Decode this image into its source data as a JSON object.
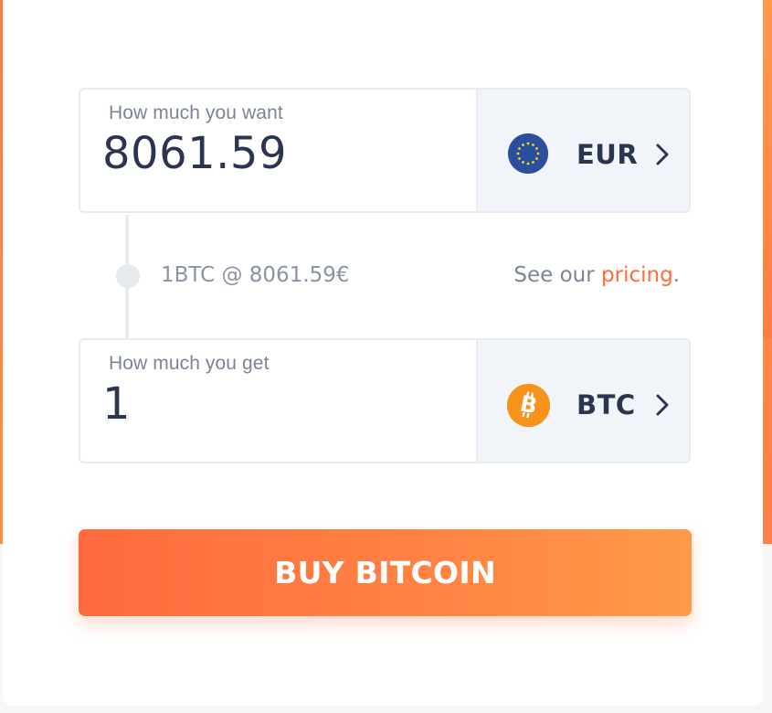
{
  "buy_form": {
    "you_want": {
      "label": "How much you want",
      "value": "8061.59",
      "currency": {
        "code": "EUR",
        "icon": "euro-flag-icon",
        "color": "#2a4f9c"
      }
    },
    "rate": {
      "text": "1BTC @ 8061.59€"
    },
    "pricing": {
      "prefix": "See our ",
      "link_text": "pricing",
      "suffix": "."
    },
    "you_get": {
      "label": "How much you get",
      "value": "1",
      "currency": {
        "code": "BTC",
        "icon": "bitcoin-icon",
        "color": "#f7931a"
      }
    },
    "submit_label": "BUY BITCOIN"
  },
  "colors": {
    "accent": "#ff6b3d",
    "accent_gradient_end": "#ff9a48",
    "text_dark": "#2c3550",
    "text_muted": "#7b8596",
    "field_border": "#e8ebf0",
    "currency_bg": "#f1f5fa"
  }
}
